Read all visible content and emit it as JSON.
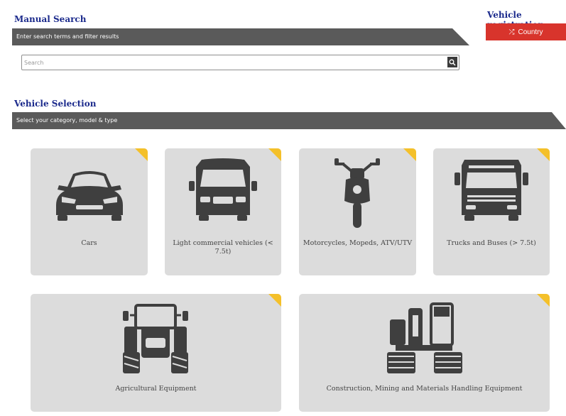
{
  "manual_search": {
    "title": "Manual Search",
    "banner": "Enter search terms and filter results",
    "search_placeholder": "Search"
  },
  "vehicle_registration": {
    "title": "Vehicle registration",
    "country_button": "Country",
    "button_color": "#d8342c"
  },
  "vehicle_selection": {
    "title": "Vehicle Selection",
    "banner": "Select your category, model & type",
    "categories": [
      {
        "label": "Cars",
        "icon": "car-icon"
      },
      {
        "label": "Light commercial vehicles (< 7.5t)",
        "icon": "van-icon"
      },
      {
        "label": "Motorcycles, Mopeds, ATV/UTV",
        "icon": "motorcycle-icon"
      },
      {
        "label": "Trucks and Buses (> 7.5t)",
        "icon": "truck-icon"
      },
      {
        "label": "Agricultural Equipment",
        "icon": "tractor-icon"
      },
      {
        "label": "Construction, Mining and Materials Handling Equipment",
        "icon": "excavator-icon"
      }
    ],
    "accent_color": "#f4c02a"
  }
}
